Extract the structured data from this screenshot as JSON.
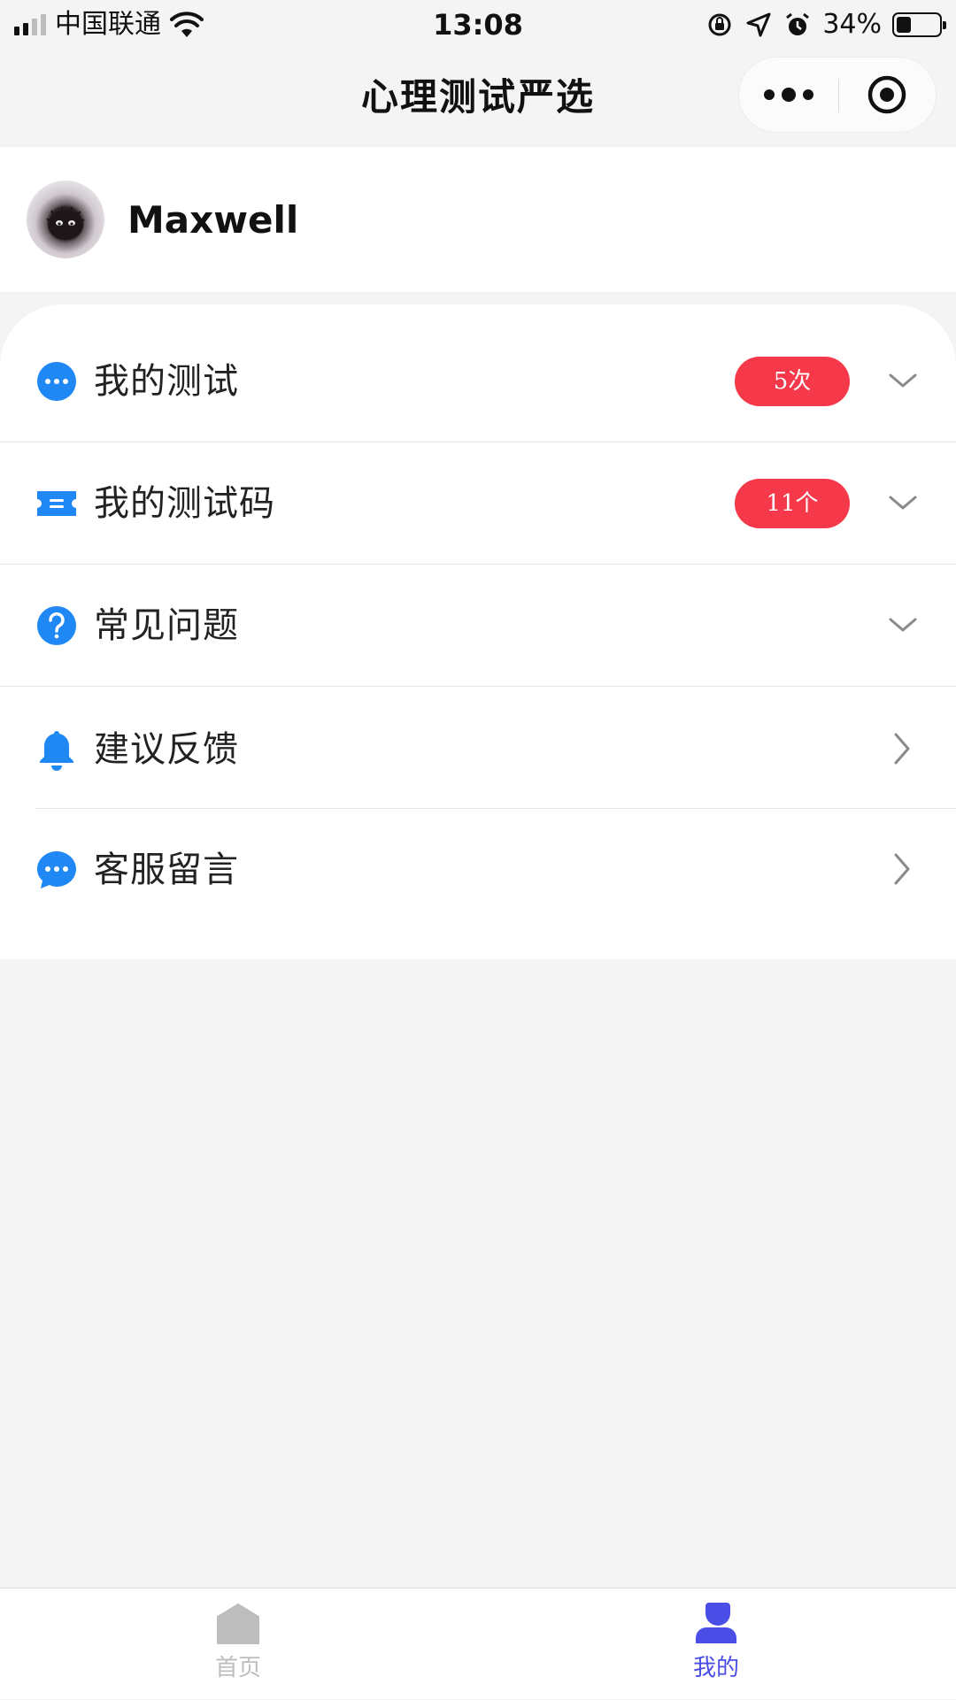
{
  "status_bar": {
    "carrier": "中国联通",
    "time": "13:08",
    "battery_percent": "34%",
    "battery_level": 0.34
  },
  "nav": {
    "title": "心理测试严选"
  },
  "profile": {
    "username": "Maxwell"
  },
  "menu": {
    "items": [
      {
        "label": "我的测试",
        "badge": "5次",
        "icon": "chat-dots-icon",
        "arrow": "chevron-down-icon"
      },
      {
        "label": "我的测试码",
        "badge": "11个",
        "icon": "ticket-icon",
        "arrow": "chevron-down-icon"
      },
      {
        "label": "常见问题",
        "icon": "question-icon",
        "arrow": "chevron-down-icon"
      },
      {
        "label": "建议反馈",
        "icon": "bell-icon",
        "arrow": "chevron-right-icon"
      },
      {
        "label": "客服留言",
        "icon": "message-icon",
        "arrow": "chevron-right-icon"
      }
    ]
  },
  "tabs": [
    {
      "label": "首页",
      "icon": "home-icon",
      "active": false
    },
    {
      "label": "我的",
      "icon": "profile-icon",
      "active": true
    }
  ],
  "colors": {
    "accent_blue": "#1f88f5",
    "badge_red": "#f5394a",
    "tab_active": "#4a4de6",
    "tab_inactive": "#bdbdbd",
    "page_background": "#f4f4f4"
  }
}
